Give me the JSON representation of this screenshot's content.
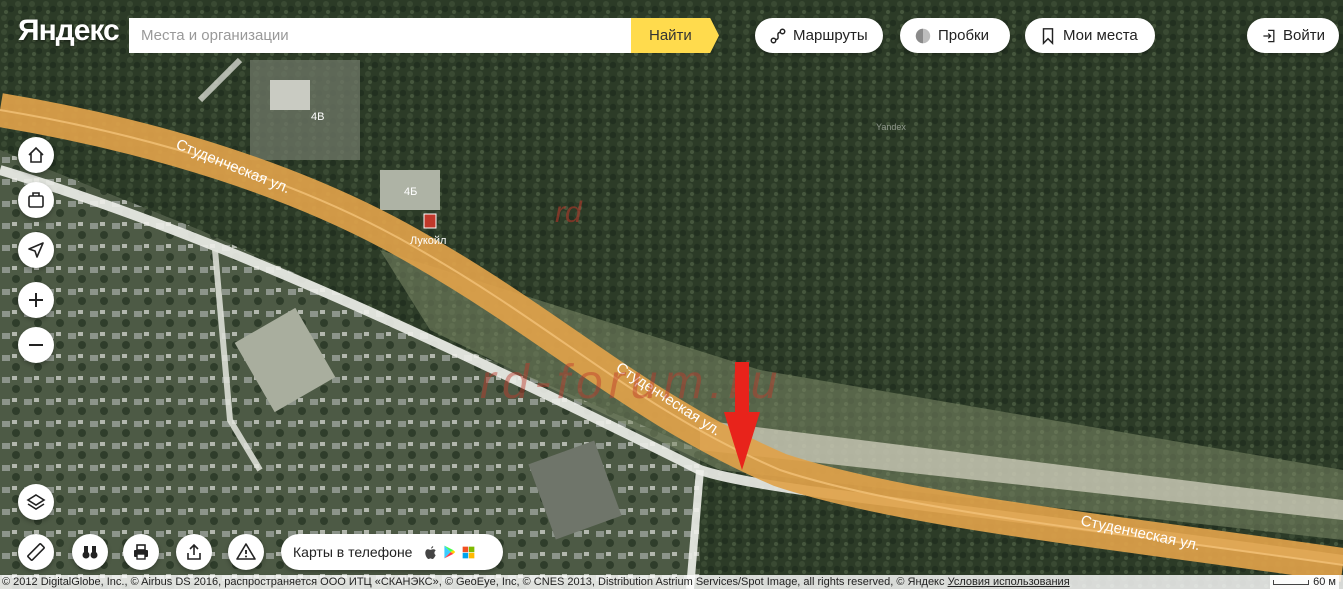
{
  "header": {
    "logo": "Яндекс",
    "search_placeholder": "Места и организации",
    "search_value": "",
    "find_label": "Найти",
    "routes_label": "Маршруты",
    "traffic_label": "Пробки",
    "my_places_label": "Мои места",
    "login_label": "Войти"
  },
  "map": {
    "street_labels": [
      "Студенческая ул.",
      "Студенческая ул.",
      "Студенческая ул."
    ],
    "poi_labels": [
      "4В",
      "4Б",
      "Лукойл"
    ],
    "watermark": "rd-forum.ru",
    "watermark_small": "rd",
    "yandex_mark": "Yandex",
    "marker": "red-arrow"
  },
  "controls": {
    "left": [
      "home-icon",
      "briefcase-icon",
      "navigation-arrow-icon",
      "zoom-in-icon",
      "zoom-out-icon",
      "layers-icon"
    ],
    "bottom": [
      "ruler-icon",
      "binoculars-icon",
      "printer-icon",
      "share-icon",
      "warning-icon"
    ]
  },
  "phone_promo": {
    "label": "Карты в телефоне",
    "stores": [
      "apple-icon",
      "google-play-icon",
      "windows-icon"
    ]
  },
  "footer": {
    "attribution": "© 2012 DigitalGlobe, Inc., © Airbus DS 2016, распространяется ООО ИТЦ «СКАНЭКС», © GeoEye, Inc, © CNES 2013, Distribution Astrium Services/Spot Image, all rights reserved, © Яндекс",
    "terms_link": "Условия использования",
    "scale_label": "60 м"
  },
  "colors": {
    "road": "#e0a24a",
    "forest": "#2b3a26",
    "accent": "#ffdb4d",
    "marker": "#e8231b"
  }
}
